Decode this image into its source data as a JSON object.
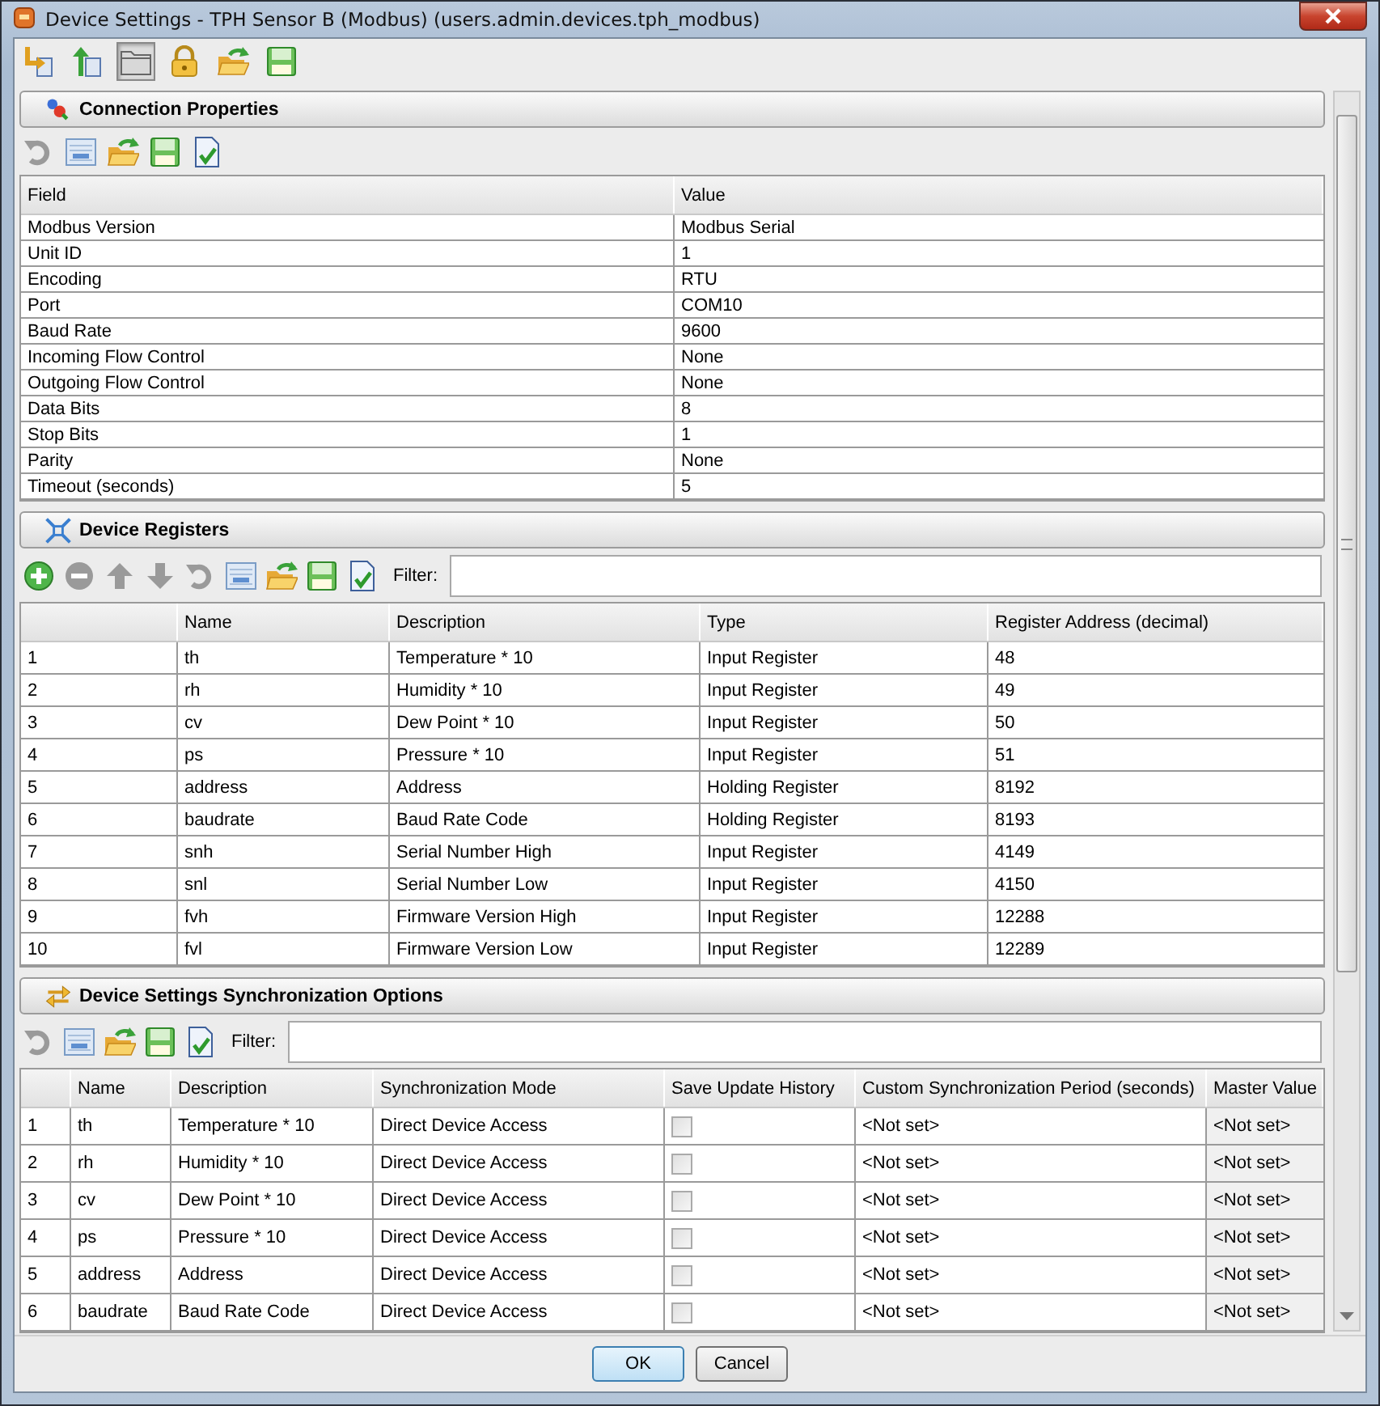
{
  "window": {
    "title": "Device Settings - TPH Sensor B (Modbus) (users.admin.devices.tph_modbus)"
  },
  "toolbar": [
    {
      "kind": "import",
      "selected": false
    },
    {
      "kind": "export",
      "selected": false
    },
    {
      "kind": "folder",
      "selected": true
    },
    {
      "kind": "lock",
      "selected": false
    },
    {
      "kind": "open",
      "selected": false
    },
    {
      "kind": "save",
      "selected": false
    }
  ],
  "sections": [
    {
      "kind": "connection",
      "title": "Connection Properties",
      "toolbar": [
        {
          "kind": "undo",
          "disabled": true
        },
        {
          "kind": "edit",
          "disabled": false
        },
        {
          "kind": "open",
          "disabled": false
        },
        {
          "kind": "save",
          "disabled": false
        },
        {
          "kind": "verify",
          "disabled": false
        }
      ],
      "table": {
        "columns": [
          "Field",
          "Value"
        ],
        "rows": [
          [
            "Modbus Version",
            "Modbus Serial"
          ],
          [
            "Unit ID",
            "1"
          ],
          [
            "Encoding",
            "RTU"
          ],
          [
            "Port",
            "COM10"
          ],
          [
            "Baud Rate",
            "9600"
          ],
          [
            "Incoming Flow Control",
            "None"
          ],
          [
            "Outgoing Flow Control",
            "None"
          ],
          [
            "Data Bits",
            "8"
          ],
          [
            "Stop Bits",
            "1"
          ],
          [
            "Parity",
            "None"
          ],
          [
            "Timeout (seconds)",
            "5"
          ]
        ]
      }
    },
    {
      "kind": "registers",
      "title": "Device Registers",
      "toolbar": [
        {
          "kind": "add",
          "disabled": false
        },
        {
          "kind": "remove",
          "disabled": true
        },
        {
          "kind": "up",
          "disabled": true
        },
        {
          "kind": "down",
          "disabled": true
        },
        {
          "kind": "undo",
          "disabled": true
        },
        {
          "kind": "edit",
          "disabled": false
        },
        {
          "kind": "open",
          "disabled": false
        },
        {
          "kind": "save",
          "disabled": false
        },
        {
          "kind": "verify",
          "disabled": false
        }
      ],
      "filter": {
        "label": "Filter:"
      },
      "table": {
        "columns": [
          "",
          "Name",
          "Description",
          "Type",
          "Register Address (decimal)"
        ],
        "rows": [
          [
            "1",
            "th",
            "Temperature * 10",
            "Input Register",
            "48"
          ],
          [
            "2",
            "rh",
            "Humidity * 10",
            "Input Register",
            "49"
          ],
          [
            "3",
            "cv",
            "Dew Point * 10",
            "Input Register",
            "50"
          ],
          [
            "4",
            "ps",
            "Pressure * 10",
            "Input Register",
            "51"
          ],
          [
            "5",
            "address",
            "Address",
            "Holding Register",
            "8192"
          ],
          [
            "6",
            "baudrate",
            "Baud Rate Code",
            "Holding Register",
            "8193"
          ],
          [
            "7",
            "snh",
            "Serial Number High",
            "Input Register",
            "4149"
          ],
          [
            "8",
            "snl",
            "Serial Number Low",
            "Input Register",
            "4150"
          ],
          [
            "9",
            "fvh",
            "Firmware Version High",
            "Input Register",
            "12288"
          ],
          [
            "10",
            "fvl",
            "Firmware Version Low",
            "Input Register",
            "12289"
          ]
        ]
      }
    },
    {
      "kind": "sync",
      "title": "Device Settings Synchronization Options",
      "toolbar": [
        {
          "kind": "undo",
          "disabled": true
        },
        {
          "kind": "edit",
          "disabled": false
        },
        {
          "kind": "open",
          "disabled": false
        },
        {
          "kind": "save",
          "disabled": false
        },
        {
          "kind": "verify",
          "disabled": false
        }
      ],
      "filter": {
        "label": "Filter:"
      },
      "table": {
        "columns": [
          "",
          "Name",
          "Description",
          "Synchronization Mode",
          "Save Update History",
          "Custom Synchronization Period (seconds)",
          "Master Value"
        ],
        "rows": [
          [
            "1",
            "th",
            "Temperature * 10",
            "Direct Device Access",
            {
              "kind": "checkbox",
              "checked": false,
              "disabled": true
            },
            "<Not set>",
            "<Not set>"
          ],
          [
            "2",
            "rh",
            "Humidity * 10",
            "Direct Device Access",
            {
              "kind": "checkbox",
              "checked": false,
              "disabled": true
            },
            "<Not set>",
            "<Not set>"
          ],
          [
            "3",
            "cv",
            "Dew Point * 10",
            "Direct Device Access",
            {
              "kind": "checkbox",
              "checked": false,
              "disabled": true
            },
            "<Not set>",
            "<Not set>"
          ],
          [
            "4",
            "ps",
            "Pressure * 10",
            "Direct Device Access",
            {
              "kind": "checkbox",
              "checked": false,
              "disabled": true
            },
            "<Not set>",
            "<Not set>"
          ],
          [
            "5",
            "address",
            "Address",
            "Direct Device Access",
            {
              "kind": "checkbox",
              "checked": false,
              "disabled": true
            },
            "<Not set>",
            "<Not set>"
          ],
          [
            "6",
            "baudrate",
            "Baud Rate Code",
            "Direct Device Access",
            {
              "kind": "checkbox",
              "checked": false,
              "disabled": true
            },
            "<Not set>",
            "<Not set>"
          ]
        ]
      }
    }
  ],
  "buttons": [
    {
      "label": "OK",
      "selected": true
    },
    {
      "label": "Cancel",
      "selected": false
    }
  ]
}
